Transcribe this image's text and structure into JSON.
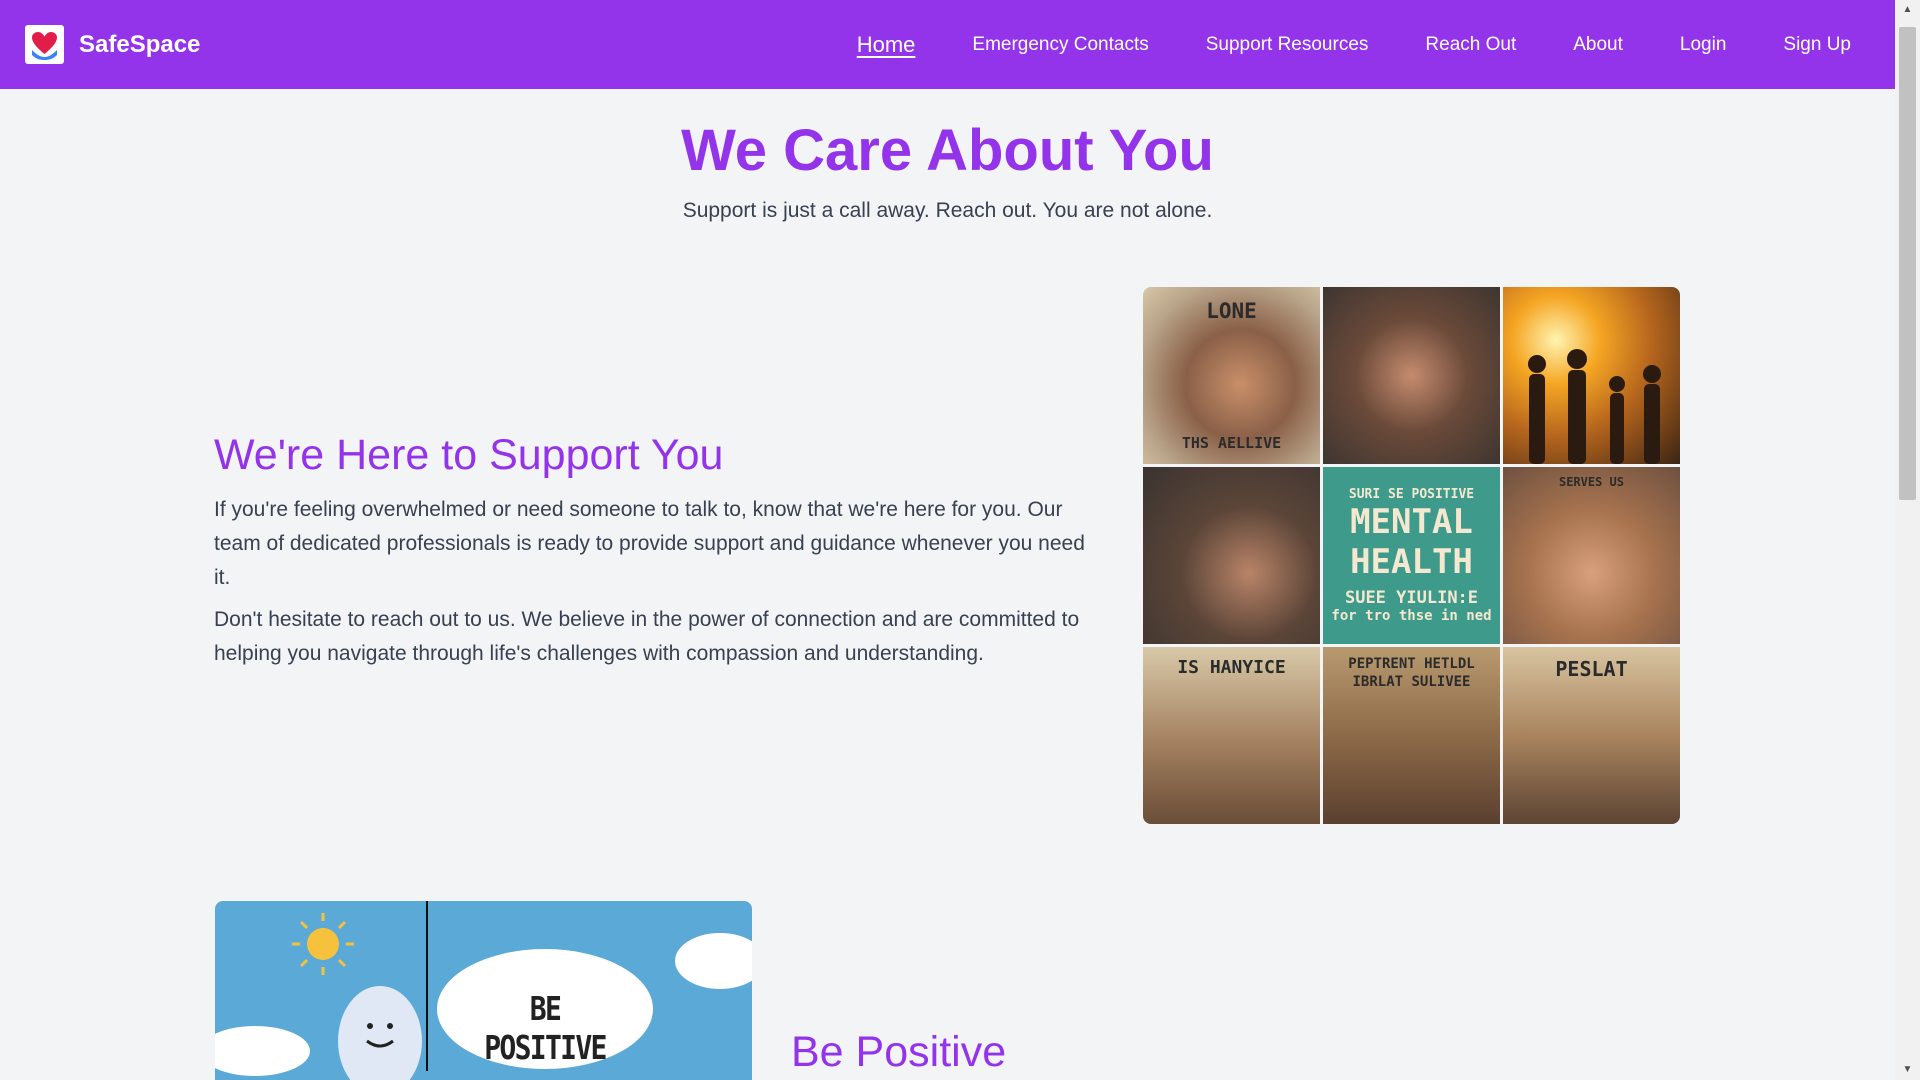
{
  "nav": {
    "brand": "SafeSpace",
    "links": [
      {
        "label": "Home"
      },
      {
        "label": "Emergency Contacts"
      },
      {
        "label": "Support Resources"
      },
      {
        "label": "Reach Out"
      },
      {
        "label": "About"
      },
      {
        "label": "Login"
      },
      {
        "label": "Sign Up"
      }
    ]
  },
  "hero": {
    "title": "We Care About You",
    "subtitle": "Support is just a call away. Reach out. You are not alone."
  },
  "support_section": {
    "heading": "We're Here to Support You",
    "paragraphs": [
      "If you're feeling overwhelmed or need someone to talk to, know that we're here for you. Our team of dedicated professionals is ready to provide support and guidance whenever you need it.",
      "Don't hesitate to reach out to us. We believe in the power of connection and are committed to helping you navigate through life's challenges with compassion and understanding."
    ],
    "collage_texts": {
      "tile1_top": "LONE",
      "tile1_bottom": "THS AELLIVE",
      "tile5_line1": "SURI SE POSITIVE",
      "tile5_line2": "MENTAL",
      "tile5_line3": "HEALTH",
      "tile5_line4": "SUEE YIULIN:E",
      "tile5_line5": "for tro thse in ned",
      "tile6_top": "SERVES US",
      "tile7_top": "IS HANYICE",
      "tile8_text": "PEPTRENT HETLDL IBRLAT SULIVEE",
      "tile9_top": "PESLAT"
    }
  },
  "positive_section": {
    "heading": "Be Positive",
    "image_text": "BE POSITIVE"
  },
  "colors": {
    "brand": "#9333ea",
    "background": "#f3f4f6",
    "text": "#374151"
  }
}
